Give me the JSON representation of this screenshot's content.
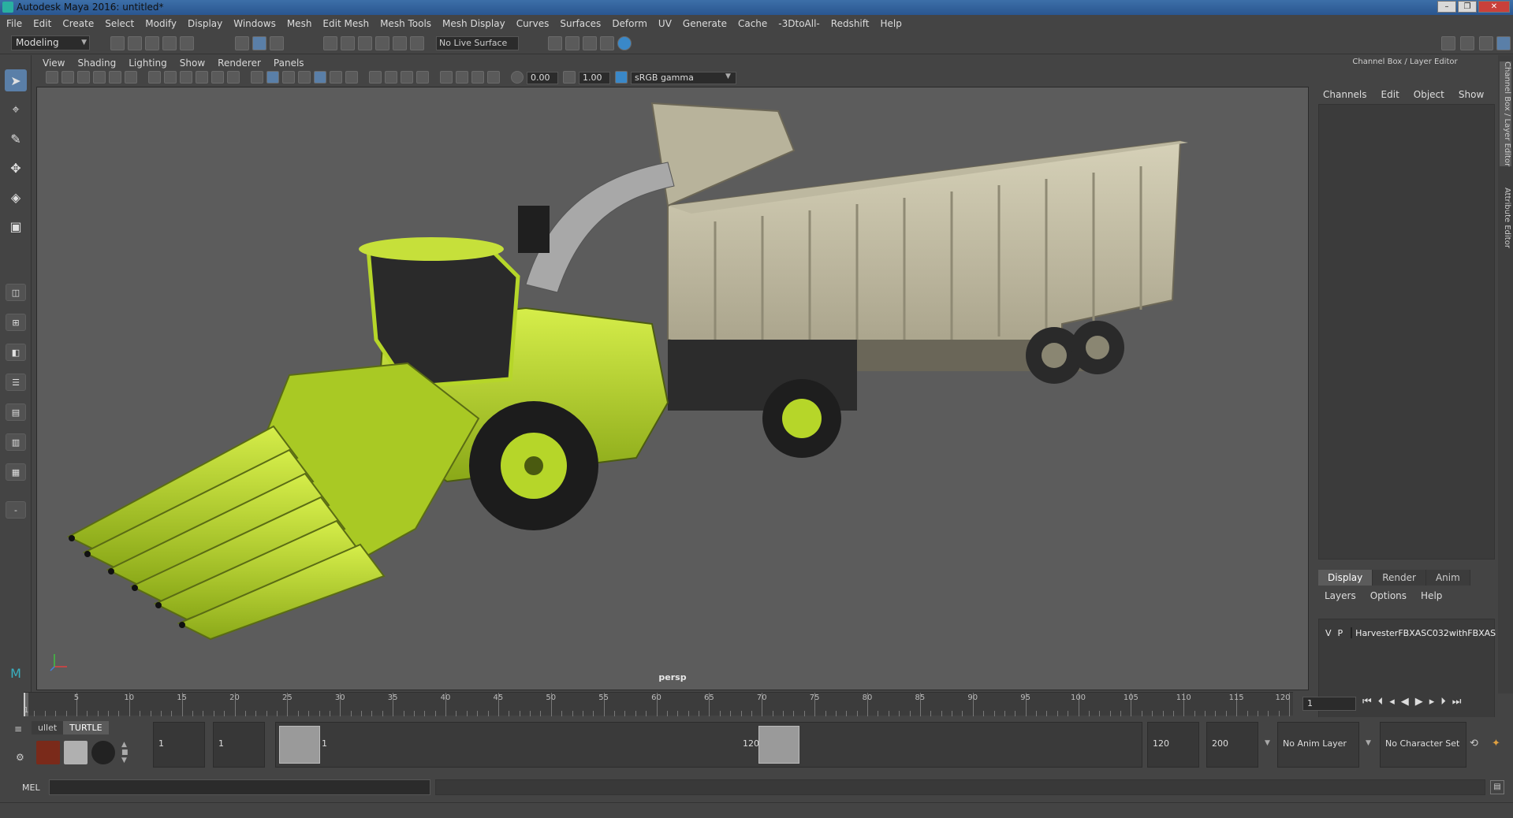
{
  "window": {
    "title": "Autodesk Maya 2016: untitled*"
  },
  "menus": [
    "File",
    "Edit",
    "Create",
    "Select",
    "Modify",
    "Display",
    "Windows",
    "Mesh",
    "Edit Mesh",
    "Mesh Tools",
    "Mesh Display",
    "Curves",
    "Surfaces",
    "Deform",
    "UV",
    "Generate",
    "Cache",
    "-3DtoAll-",
    "Redshift",
    "Help"
  ],
  "statusline": {
    "mode": "Modeling",
    "live_surface": "No Live Surface"
  },
  "viewport": {
    "menus": [
      "View",
      "Shading",
      "Lighting",
      "Show",
      "Renderer",
      "Panels"
    ],
    "value_a": "0.00",
    "value_b": "1.00",
    "color_space": "sRGB gamma",
    "camera_label": "persp"
  },
  "channel_box": {
    "title": "Channel Box / Layer Editor",
    "menus": [
      "Channels",
      "Edit",
      "Object",
      "Show"
    ]
  },
  "layer_editor": {
    "tabs": [
      "Display",
      "Render",
      "Anim"
    ],
    "active_tab": "Display",
    "menus": [
      "Layers",
      "Options",
      "Help"
    ],
    "layer": {
      "v": "V",
      "p": "P",
      "name": "HarvesterFBXASC032withFBXAS",
      "color": "#a02030"
    }
  },
  "side_tabs": [
    "Channel Box / Layer Editor",
    "Attribute Editor"
  ],
  "timeline": {
    "ticks": [
      "5",
      "10",
      "15",
      "20",
      "25",
      "30",
      "35",
      "40",
      "45",
      "50",
      "55",
      "60",
      "65",
      "70",
      "75",
      "80",
      "85",
      "90",
      "95",
      "100",
      "105",
      "110",
      "115",
      "120"
    ],
    "start_marker": "1",
    "current_frame": "1"
  },
  "shelf": {
    "tabs": [
      "ullet",
      "TURTLE"
    ],
    "active_tab": "TURTLE"
  },
  "range": {
    "start_time": "1",
    "playback_start": "1",
    "range_start_label": "1",
    "range_end_label": "120",
    "playback_end": "120",
    "end_time": "200",
    "anim_layer": "No Anim Layer",
    "character_set": "No Character Set"
  },
  "command_line": {
    "label": "MEL"
  },
  "colors": {
    "accent": "#5a7fa8",
    "harvester": "#b6d629",
    "trailer": "#c9c3a8"
  }
}
